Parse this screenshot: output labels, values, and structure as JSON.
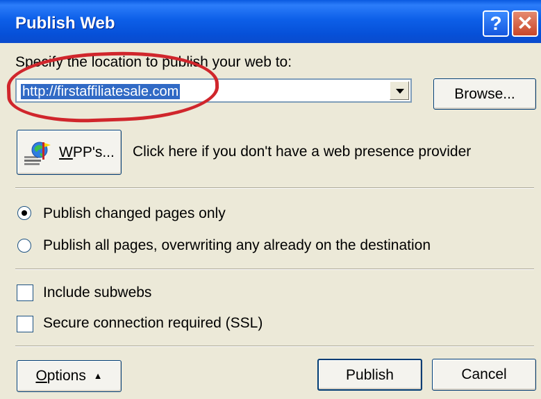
{
  "window": {
    "title": "Publish Web",
    "help_label": "?",
    "close_label": "✕"
  },
  "location": {
    "prompt": "Specify the location to publish your web to:",
    "value": "http://firstaffiliatesale.com",
    "browse_label": "Browse..."
  },
  "wpp": {
    "button_label": "WPP's...",
    "description": "Click here if you don't have a web presence provider"
  },
  "publish_mode": {
    "options": [
      {
        "label": "Publish changed pages only",
        "selected": true
      },
      {
        "label": "Publish all pages, overwriting any already on the destination",
        "selected": false
      }
    ]
  },
  "checkboxes": [
    {
      "label": "Include subwebs",
      "checked": false
    },
    {
      "label": "Secure connection required (SSL)",
      "checked": false
    }
  ],
  "buttons": {
    "options_label": "Options",
    "options_arrow": "▲",
    "publish_label": "Publish",
    "cancel_label": "Cancel"
  },
  "colors": {
    "titlebar": "#0650d8",
    "dialog_bg": "#ece9d8",
    "selection": "#316ac5",
    "annotation": "#d0262c"
  }
}
